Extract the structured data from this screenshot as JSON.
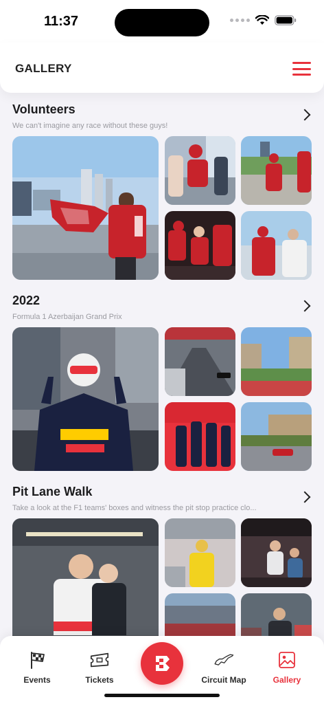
{
  "status_bar": {
    "time": "11:37"
  },
  "header": {
    "title": "GALLERY"
  },
  "sections": [
    {
      "title": "Volunteers",
      "subtitle": "We can't imagine any race without these guys!"
    },
    {
      "title": "2022",
      "subtitle": "Formula 1 Azerbaijan Grand Prix"
    },
    {
      "title": "Pit Lane Walk",
      "subtitle": "Take a look at the F1 teams' boxes and witness the pit stop practice clo..."
    }
  ],
  "tabbar": {
    "items": [
      {
        "label": "Events",
        "icon": "checkered-flag-icon"
      },
      {
        "label": "Tickets",
        "icon": "ticket-icon"
      },
      {
        "label": "",
        "icon": "brand-logo-icon"
      },
      {
        "label": "Circuit Map",
        "icon": "circuit-map-icon"
      },
      {
        "label": "Gallery",
        "icon": "image-icon"
      }
    ],
    "active": "Gallery"
  },
  "colors": {
    "accent": "#e8323c",
    "background": "#f4f3f8",
    "text": "#1c1c1e",
    "muted": "#9a9aa0"
  }
}
